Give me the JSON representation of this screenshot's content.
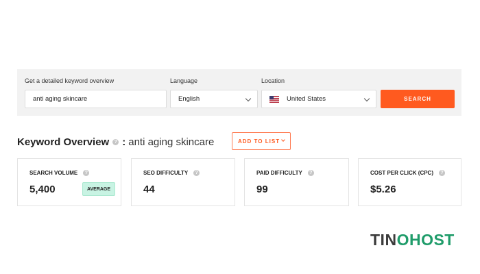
{
  "search": {
    "keyword_label": "Get a detailed keyword overview",
    "keyword_value": "anti aging skincare",
    "language_label": "Language",
    "language_value": "English",
    "location_label": "Location",
    "location_value": "United States",
    "search_button": "SEARCH"
  },
  "overview": {
    "title": "Keyword Overview",
    "separator": ":",
    "keyword": "anti aging skincare",
    "add_to_list": "ADD TO LIST"
  },
  "metrics": [
    {
      "label": "SEARCH VOLUME",
      "value": "5,400",
      "badge": "AVERAGE"
    },
    {
      "label": "SEO DIFFICULTY",
      "value": "44"
    },
    {
      "label": "PAID DIFFICULTY",
      "value": "99"
    },
    {
      "label": "COST PER CLICK (CPC)",
      "value": "$5.26"
    }
  ],
  "logo": {
    "part1": "TIN",
    "part2": "O",
    "part3": "HOST"
  },
  "colors": {
    "accent": "#ff5a1f",
    "badge_bg": "#c8f3e3",
    "logo_green": "#1f9c6a"
  }
}
